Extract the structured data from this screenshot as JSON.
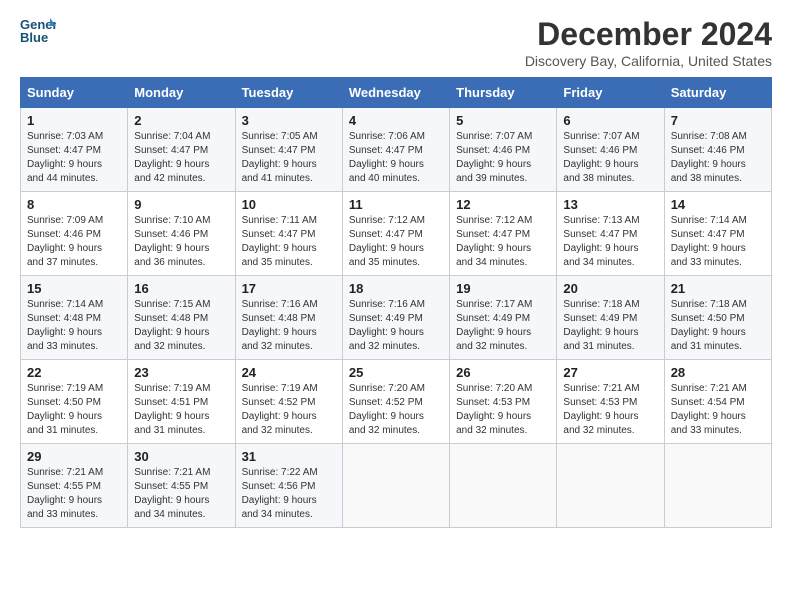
{
  "header": {
    "logo_line1": "General",
    "logo_line2": "Blue",
    "title": "December 2024",
    "subtitle": "Discovery Bay, California, United States"
  },
  "columns": [
    "Sunday",
    "Monday",
    "Tuesday",
    "Wednesday",
    "Thursday",
    "Friday",
    "Saturday"
  ],
  "weeks": [
    [
      {
        "day": "1",
        "sunrise": "Sunrise: 7:03 AM",
        "sunset": "Sunset: 4:47 PM",
        "daylight": "Daylight: 9 hours and 44 minutes."
      },
      {
        "day": "2",
        "sunrise": "Sunrise: 7:04 AM",
        "sunset": "Sunset: 4:47 PM",
        "daylight": "Daylight: 9 hours and 42 minutes."
      },
      {
        "day": "3",
        "sunrise": "Sunrise: 7:05 AM",
        "sunset": "Sunset: 4:47 PM",
        "daylight": "Daylight: 9 hours and 41 minutes."
      },
      {
        "day": "4",
        "sunrise": "Sunrise: 7:06 AM",
        "sunset": "Sunset: 4:47 PM",
        "daylight": "Daylight: 9 hours and 40 minutes."
      },
      {
        "day": "5",
        "sunrise": "Sunrise: 7:07 AM",
        "sunset": "Sunset: 4:46 PM",
        "daylight": "Daylight: 9 hours and 39 minutes."
      },
      {
        "day": "6",
        "sunrise": "Sunrise: 7:07 AM",
        "sunset": "Sunset: 4:46 PM",
        "daylight": "Daylight: 9 hours and 38 minutes."
      },
      {
        "day": "7",
        "sunrise": "Sunrise: 7:08 AM",
        "sunset": "Sunset: 4:46 PM",
        "daylight": "Daylight: 9 hours and 38 minutes."
      }
    ],
    [
      {
        "day": "8",
        "sunrise": "Sunrise: 7:09 AM",
        "sunset": "Sunset: 4:46 PM",
        "daylight": "Daylight: 9 hours and 37 minutes."
      },
      {
        "day": "9",
        "sunrise": "Sunrise: 7:10 AM",
        "sunset": "Sunset: 4:46 PM",
        "daylight": "Daylight: 9 hours and 36 minutes."
      },
      {
        "day": "10",
        "sunrise": "Sunrise: 7:11 AM",
        "sunset": "Sunset: 4:47 PM",
        "daylight": "Daylight: 9 hours and 35 minutes."
      },
      {
        "day": "11",
        "sunrise": "Sunrise: 7:12 AM",
        "sunset": "Sunset: 4:47 PM",
        "daylight": "Daylight: 9 hours and 35 minutes."
      },
      {
        "day": "12",
        "sunrise": "Sunrise: 7:12 AM",
        "sunset": "Sunset: 4:47 PM",
        "daylight": "Daylight: 9 hours and 34 minutes."
      },
      {
        "day": "13",
        "sunrise": "Sunrise: 7:13 AM",
        "sunset": "Sunset: 4:47 PM",
        "daylight": "Daylight: 9 hours and 34 minutes."
      },
      {
        "day": "14",
        "sunrise": "Sunrise: 7:14 AM",
        "sunset": "Sunset: 4:47 PM",
        "daylight": "Daylight: 9 hours and 33 minutes."
      }
    ],
    [
      {
        "day": "15",
        "sunrise": "Sunrise: 7:14 AM",
        "sunset": "Sunset: 4:48 PM",
        "daylight": "Daylight: 9 hours and 33 minutes."
      },
      {
        "day": "16",
        "sunrise": "Sunrise: 7:15 AM",
        "sunset": "Sunset: 4:48 PM",
        "daylight": "Daylight: 9 hours and 32 minutes."
      },
      {
        "day": "17",
        "sunrise": "Sunrise: 7:16 AM",
        "sunset": "Sunset: 4:48 PM",
        "daylight": "Daylight: 9 hours and 32 minutes."
      },
      {
        "day": "18",
        "sunrise": "Sunrise: 7:16 AM",
        "sunset": "Sunset: 4:49 PM",
        "daylight": "Daylight: 9 hours and 32 minutes."
      },
      {
        "day": "19",
        "sunrise": "Sunrise: 7:17 AM",
        "sunset": "Sunset: 4:49 PM",
        "daylight": "Daylight: 9 hours and 32 minutes."
      },
      {
        "day": "20",
        "sunrise": "Sunrise: 7:18 AM",
        "sunset": "Sunset: 4:49 PM",
        "daylight": "Daylight: 9 hours and 31 minutes."
      },
      {
        "day": "21",
        "sunrise": "Sunrise: 7:18 AM",
        "sunset": "Sunset: 4:50 PM",
        "daylight": "Daylight: 9 hours and 31 minutes."
      }
    ],
    [
      {
        "day": "22",
        "sunrise": "Sunrise: 7:19 AM",
        "sunset": "Sunset: 4:50 PM",
        "daylight": "Daylight: 9 hours and 31 minutes."
      },
      {
        "day": "23",
        "sunrise": "Sunrise: 7:19 AM",
        "sunset": "Sunset: 4:51 PM",
        "daylight": "Daylight: 9 hours and 31 minutes."
      },
      {
        "day": "24",
        "sunrise": "Sunrise: 7:19 AM",
        "sunset": "Sunset: 4:52 PM",
        "daylight": "Daylight: 9 hours and 32 minutes."
      },
      {
        "day": "25",
        "sunrise": "Sunrise: 7:20 AM",
        "sunset": "Sunset: 4:52 PM",
        "daylight": "Daylight: 9 hours and 32 minutes."
      },
      {
        "day": "26",
        "sunrise": "Sunrise: 7:20 AM",
        "sunset": "Sunset: 4:53 PM",
        "daylight": "Daylight: 9 hours and 32 minutes."
      },
      {
        "day": "27",
        "sunrise": "Sunrise: 7:21 AM",
        "sunset": "Sunset: 4:53 PM",
        "daylight": "Daylight: 9 hours and 32 minutes."
      },
      {
        "day": "28",
        "sunrise": "Sunrise: 7:21 AM",
        "sunset": "Sunset: 4:54 PM",
        "daylight": "Daylight: 9 hours and 33 minutes."
      }
    ],
    [
      {
        "day": "29",
        "sunrise": "Sunrise: 7:21 AM",
        "sunset": "Sunset: 4:55 PM",
        "daylight": "Daylight: 9 hours and 33 minutes."
      },
      {
        "day": "30",
        "sunrise": "Sunrise: 7:21 AM",
        "sunset": "Sunset: 4:55 PM",
        "daylight": "Daylight: 9 hours and 34 minutes."
      },
      {
        "day": "31",
        "sunrise": "Sunrise: 7:22 AM",
        "sunset": "Sunset: 4:56 PM",
        "daylight": "Daylight: 9 hours and 34 minutes."
      },
      null,
      null,
      null,
      null
    ]
  ]
}
